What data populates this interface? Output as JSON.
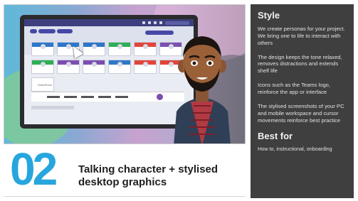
{
  "panel": {
    "title": "Style",
    "paragraphs": [
      "We create personas for your project. We bring one to life to interact with others",
      "The design keeps the tone relaxed, removes distractions and extends shelf life",
      "Icons such as the Teams logo, reinforce the app or interface",
      "The stylised screenshots of your PC and mobile workspace and cursor movements reinforce best practice"
    ],
    "best_for_title": "Best for",
    "best_for_text": "How to, instructional, onboarding"
  },
  "caption": {
    "number": "02",
    "headline": "Talking character + stylised desktop graphics"
  },
  "screen": {
    "tile_label": "SharePoint",
    "tile_colors": [
      "#2e77c9",
      "#2e77c9",
      "#2e77c9",
      "#2fae57",
      "#e2453b",
      "#7b4fb0",
      "#2fae57",
      "#7b4fb0",
      "#7b4fb0",
      "#2e77c9",
      "#e2453b",
      "#e2453b"
    ]
  }
}
